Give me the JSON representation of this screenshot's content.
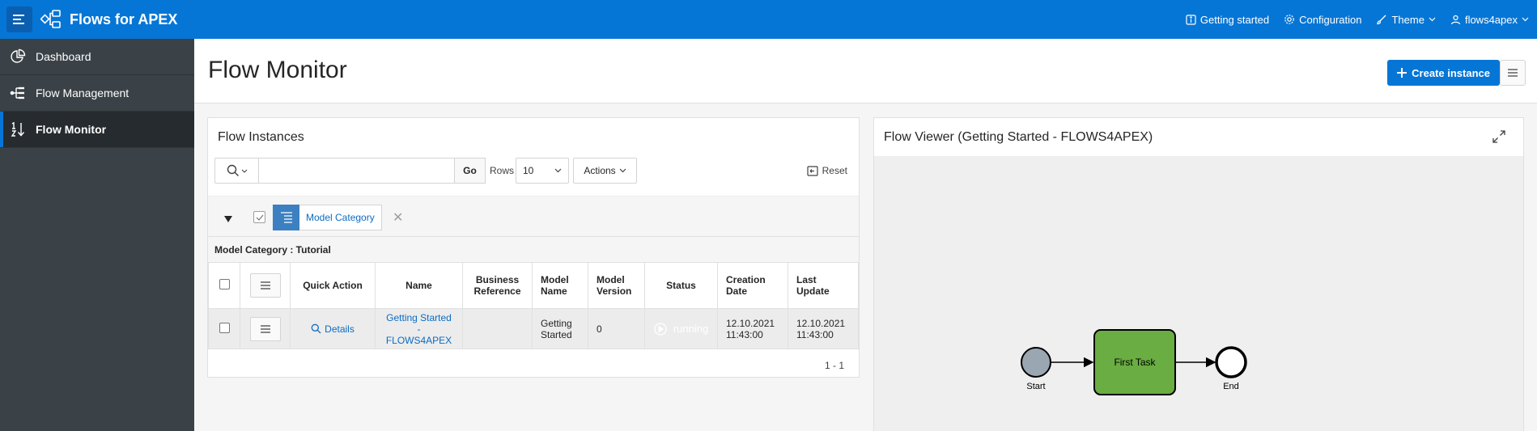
{
  "header": {
    "app_title": "Flows for APEX",
    "nav": [
      {
        "label": "Getting started",
        "icon": "info-icon"
      },
      {
        "label": "Configuration",
        "icon": "gear-icon"
      },
      {
        "label": "Theme",
        "icon": "brush-icon"
      },
      {
        "label": "flows4apex",
        "icon": "user-icon"
      }
    ],
    "colors": {
      "primary": "#0676d6"
    }
  },
  "sidebar": {
    "items": [
      {
        "label": "Dashboard",
        "icon": "pie-chart-icon",
        "active": false
      },
      {
        "label": "Flow Management",
        "icon": "tree-icon",
        "active": false
      },
      {
        "label": "Flow Monitor",
        "icon": "sort-icon",
        "active": true
      }
    ]
  },
  "page": {
    "title": "Flow Monitor",
    "create_label": "Create instance"
  },
  "instances": {
    "title": "Flow Instances",
    "search": {
      "value": "",
      "placeholder": ""
    },
    "go_label": "Go",
    "rows_label": "Rows",
    "rows_value": "10",
    "actions_label": "Actions",
    "reset_label": "Reset",
    "control_break_label": "Model Category",
    "break_group_label": "Model Category : Tutorial",
    "columns": [
      "Quick Action",
      "Name",
      "Business Reference",
      "Model Name",
      "Model Version",
      "Status",
      "Creation Date",
      "Last Update"
    ],
    "rows": [
      {
        "quick_action": "Details",
        "name": "Getting Started - FLOWS4APEX",
        "business_reference": "",
        "model_name": "Getting Started",
        "model_version": "0",
        "status": "running",
        "creation_date": "12.10.2021 11:43:00",
        "last_update": "12.10.2021 11:43:00"
      }
    ],
    "pagination": "1 - 1",
    "status_color": "#6aad42"
  },
  "viewer": {
    "title": "Flow Viewer (Getting Started - FLOWS4APEX)",
    "diagram": {
      "start_label": "Start",
      "task_label": "First Task",
      "end_label": "End",
      "task_color": "#6aad42",
      "start_color": "#9aa6b2"
    }
  }
}
